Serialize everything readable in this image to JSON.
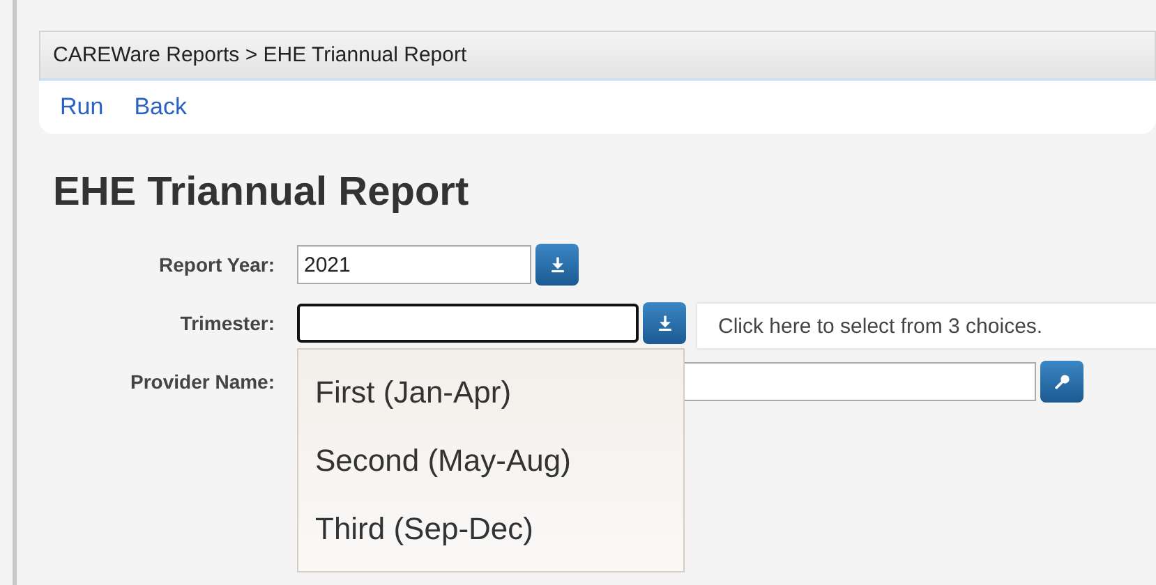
{
  "breadcrumb": "CAREWare Reports > EHE Triannual Report",
  "actions": [
    "Run",
    "Back"
  ],
  "title": "EHE Triannual Report",
  "fields": [
    {
      "label": "Report Year:",
      "kind": "select",
      "value": "2021",
      "focused": false
    },
    {
      "label": "Trimester:",
      "kind": "select",
      "focused": true
    },
    {
      "label": "Provider Name:",
      "kind": "lookup",
      "focused": false
    }
  ],
  "tooltip": "Click here to select from 3 choices.",
  "dropdown": {
    "options": [
      {
        "label": "First (Jan-Apr)",
        "selected": false
      },
      {
        "label": "Second (May-Aug)",
        "selected": false
      },
      {
        "label": "Third (Sep-Dec)",
        "selected": false
      }
    ]
  }
}
